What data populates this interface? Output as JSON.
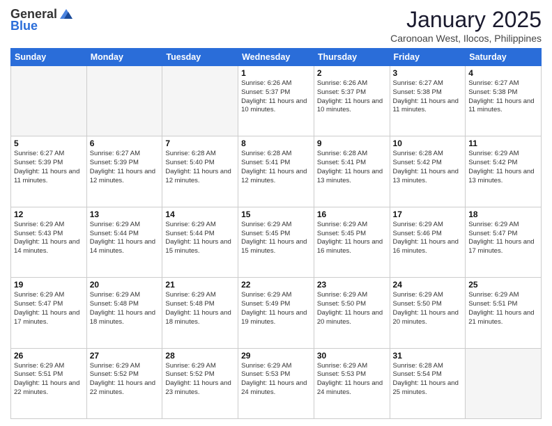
{
  "header": {
    "logo_general": "General",
    "logo_blue": "Blue",
    "month_title": "January 2025",
    "subtitle": "Caronoan West, Ilocos, Philippines"
  },
  "weekdays": [
    "Sunday",
    "Monday",
    "Tuesday",
    "Wednesday",
    "Thursday",
    "Friday",
    "Saturday"
  ],
  "weeks": [
    [
      {
        "day": "",
        "info": ""
      },
      {
        "day": "",
        "info": ""
      },
      {
        "day": "",
        "info": ""
      },
      {
        "day": "1",
        "info": "Sunrise: 6:26 AM\nSunset: 5:37 PM\nDaylight: 11 hours\nand 10 minutes."
      },
      {
        "day": "2",
        "info": "Sunrise: 6:26 AM\nSunset: 5:37 PM\nDaylight: 11 hours\nand 10 minutes."
      },
      {
        "day": "3",
        "info": "Sunrise: 6:27 AM\nSunset: 5:38 PM\nDaylight: 11 hours\nand 11 minutes."
      },
      {
        "day": "4",
        "info": "Sunrise: 6:27 AM\nSunset: 5:38 PM\nDaylight: 11 hours\nand 11 minutes."
      }
    ],
    [
      {
        "day": "5",
        "info": "Sunrise: 6:27 AM\nSunset: 5:39 PM\nDaylight: 11 hours\nand 11 minutes."
      },
      {
        "day": "6",
        "info": "Sunrise: 6:27 AM\nSunset: 5:39 PM\nDaylight: 11 hours\nand 12 minutes."
      },
      {
        "day": "7",
        "info": "Sunrise: 6:28 AM\nSunset: 5:40 PM\nDaylight: 11 hours\nand 12 minutes."
      },
      {
        "day": "8",
        "info": "Sunrise: 6:28 AM\nSunset: 5:41 PM\nDaylight: 11 hours\nand 12 minutes."
      },
      {
        "day": "9",
        "info": "Sunrise: 6:28 AM\nSunset: 5:41 PM\nDaylight: 11 hours\nand 13 minutes."
      },
      {
        "day": "10",
        "info": "Sunrise: 6:28 AM\nSunset: 5:42 PM\nDaylight: 11 hours\nand 13 minutes."
      },
      {
        "day": "11",
        "info": "Sunrise: 6:29 AM\nSunset: 5:42 PM\nDaylight: 11 hours\nand 13 minutes."
      }
    ],
    [
      {
        "day": "12",
        "info": "Sunrise: 6:29 AM\nSunset: 5:43 PM\nDaylight: 11 hours\nand 14 minutes."
      },
      {
        "day": "13",
        "info": "Sunrise: 6:29 AM\nSunset: 5:44 PM\nDaylight: 11 hours\nand 14 minutes."
      },
      {
        "day": "14",
        "info": "Sunrise: 6:29 AM\nSunset: 5:44 PM\nDaylight: 11 hours\nand 15 minutes."
      },
      {
        "day": "15",
        "info": "Sunrise: 6:29 AM\nSunset: 5:45 PM\nDaylight: 11 hours\nand 15 minutes."
      },
      {
        "day": "16",
        "info": "Sunrise: 6:29 AM\nSunset: 5:45 PM\nDaylight: 11 hours\nand 16 minutes."
      },
      {
        "day": "17",
        "info": "Sunrise: 6:29 AM\nSunset: 5:46 PM\nDaylight: 11 hours\nand 16 minutes."
      },
      {
        "day": "18",
        "info": "Sunrise: 6:29 AM\nSunset: 5:47 PM\nDaylight: 11 hours\nand 17 minutes."
      }
    ],
    [
      {
        "day": "19",
        "info": "Sunrise: 6:29 AM\nSunset: 5:47 PM\nDaylight: 11 hours\nand 17 minutes."
      },
      {
        "day": "20",
        "info": "Sunrise: 6:29 AM\nSunset: 5:48 PM\nDaylight: 11 hours\nand 18 minutes."
      },
      {
        "day": "21",
        "info": "Sunrise: 6:29 AM\nSunset: 5:48 PM\nDaylight: 11 hours\nand 18 minutes."
      },
      {
        "day": "22",
        "info": "Sunrise: 6:29 AM\nSunset: 5:49 PM\nDaylight: 11 hours\nand 19 minutes."
      },
      {
        "day": "23",
        "info": "Sunrise: 6:29 AM\nSunset: 5:50 PM\nDaylight: 11 hours\nand 20 minutes."
      },
      {
        "day": "24",
        "info": "Sunrise: 6:29 AM\nSunset: 5:50 PM\nDaylight: 11 hours\nand 20 minutes."
      },
      {
        "day": "25",
        "info": "Sunrise: 6:29 AM\nSunset: 5:51 PM\nDaylight: 11 hours\nand 21 minutes."
      }
    ],
    [
      {
        "day": "26",
        "info": "Sunrise: 6:29 AM\nSunset: 5:51 PM\nDaylight: 11 hours\nand 22 minutes."
      },
      {
        "day": "27",
        "info": "Sunrise: 6:29 AM\nSunset: 5:52 PM\nDaylight: 11 hours\nand 22 minutes."
      },
      {
        "day": "28",
        "info": "Sunrise: 6:29 AM\nSunset: 5:52 PM\nDaylight: 11 hours\nand 23 minutes."
      },
      {
        "day": "29",
        "info": "Sunrise: 6:29 AM\nSunset: 5:53 PM\nDaylight: 11 hours\nand 24 minutes."
      },
      {
        "day": "30",
        "info": "Sunrise: 6:29 AM\nSunset: 5:53 PM\nDaylight: 11 hours\nand 24 minutes."
      },
      {
        "day": "31",
        "info": "Sunrise: 6:28 AM\nSunset: 5:54 PM\nDaylight: 11 hours\nand 25 minutes."
      },
      {
        "day": "",
        "info": ""
      }
    ]
  ]
}
